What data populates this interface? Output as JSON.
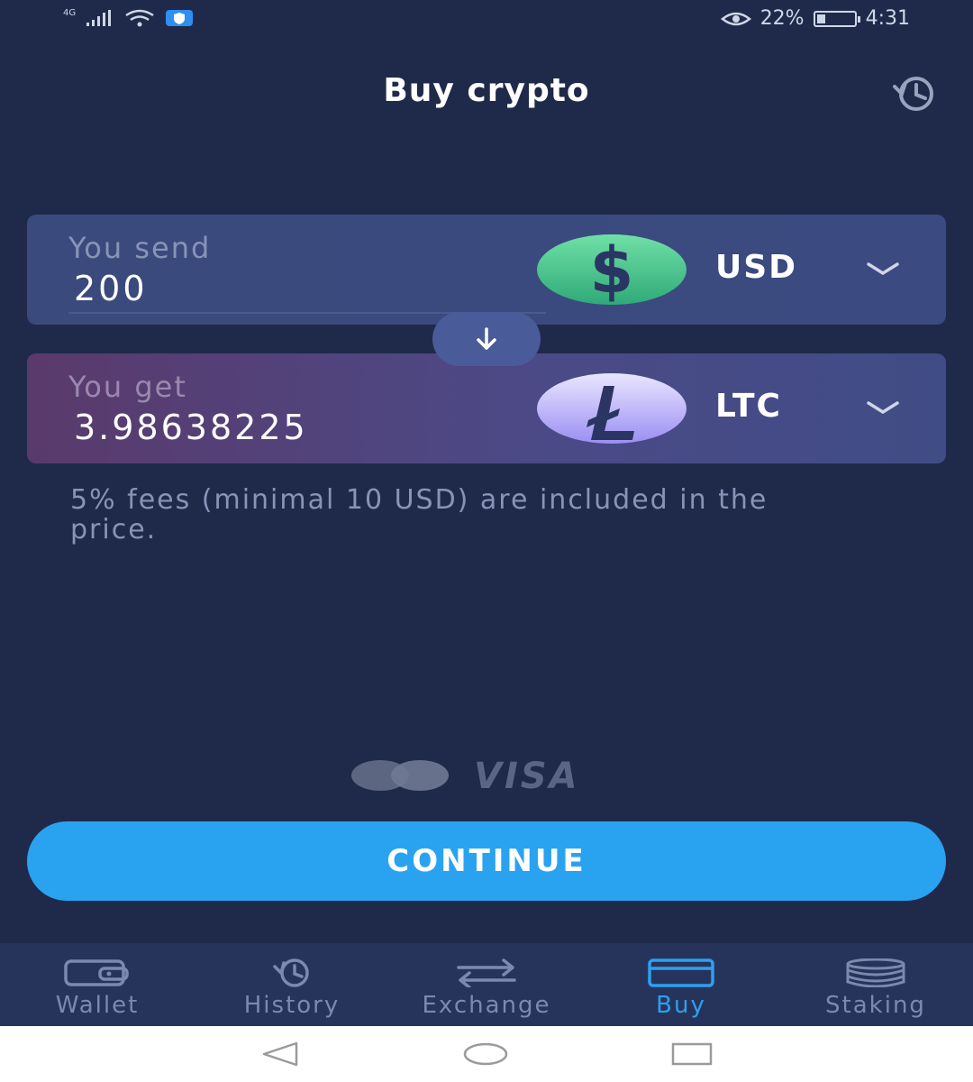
{
  "status_bar": {
    "network": "4G",
    "battery_percent": "22%",
    "battery_level": 0.22,
    "time": "4:31"
  },
  "header": {
    "title": "Buy crypto"
  },
  "send": {
    "label": "You send",
    "amount": "200",
    "currency": "USD",
    "coin_icon": "dollar-coin-icon"
  },
  "get": {
    "label": "You get",
    "amount": "3.98638225",
    "currency": "LTC",
    "coin_icon": "litecoin-icon"
  },
  "fee_note": "5% fees (minimal 10 USD) are included in the price.",
  "payment_methods": [
    "mastercard",
    "VISA"
  ],
  "continue_label": "CONTINUE",
  "tabs": [
    {
      "label": "Wallet",
      "icon": "wallet-icon",
      "active": false
    },
    {
      "label": "History",
      "icon": "history-icon",
      "active": false
    },
    {
      "label": "Exchange",
      "icon": "exchange-icon",
      "active": false
    },
    {
      "label": "Buy",
      "icon": "card-icon",
      "active": true
    },
    {
      "label": "Staking",
      "icon": "coins-stack-icon",
      "active": false
    }
  ],
  "colors": {
    "background": "#1f2a4b",
    "accent": "#29a3f0",
    "usd_coin": "#3cc48a",
    "ltc_coin": "#a99ef5"
  }
}
